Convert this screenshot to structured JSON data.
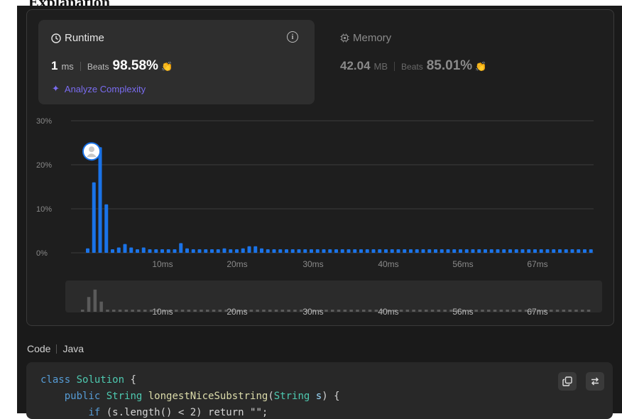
{
  "page_heading_fragment": "Explanation",
  "runtime": {
    "title": "Runtime",
    "value": "1",
    "unit": "ms",
    "beats_label": "Beats",
    "beats_pct": "98.58%",
    "analyze_label": "Analyze Complexity"
  },
  "memory": {
    "title": "Memory",
    "value": "42.04",
    "unit": "MB",
    "beats_label": "Beats",
    "beats_pct": "85.01%"
  },
  "colors": {
    "accent_bar": "#1a73e8",
    "beats_green": "#2db55d",
    "analyze_purple": "#7a6cf0"
  },
  "chart_data": {
    "type": "bar",
    "y_tick_labels": [
      "30%",
      "20%",
      "10%",
      "0%"
    ],
    "ylim": [
      0,
      30
    ],
    "x_tick_labels": [
      "10ms",
      "20ms",
      "30ms",
      "40ms",
      "56ms",
      "67ms"
    ],
    "values": [
      1,
      16,
      24,
      11,
      0.8,
      1.2,
      2,
      1.2,
      0.8,
      1.2,
      0.8,
      0.8,
      0.8,
      0.8,
      0.8,
      2.2,
      1,
      0.8,
      0.8,
      0.8,
      0.8,
      0.8,
      1,
      0.8,
      0.8,
      1,
      1.5,
      1.5,
      1,
      0.8,
      0.8,
      0.8,
      0.8,
      0.8,
      0.8,
      0.8,
      0.8,
      0.8,
      0.8,
      0.8,
      0.8,
      0.8,
      0.8,
      0.8,
      0.8,
      0.8,
      0.8,
      0.8,
      0.8,
      0.8,
      0.8,
      0.8,
      0.8,
      0.8,
      0.8,
      0.8,
      0.8,
      0.8,
      0.8,
      0.8,
      0.8,
      0.8,
      0.8,
      0.8,
      0.8,
      0.8,
      0.8,
      0.8,
      0.8,
      0.8,
      0.8,
      0.8,
      0.8,
      0.8,
      0.8,
      0.8,
      0.8,
      0.8,
      0.8,
      0.8,
      0.8,
      0.8
    ],
    "marker_index": 2,
    "grid": true,
    "legend": "none"
  },
  "code": {
    "label": "Code",
    "language": "Java",
    "line1_class": "class",
    "line1_name": "Solution",
    "line1_brace": "{",
    "line2_public": "public",
    "line2_type": "String",
    "line2_method": "longestNiceSubstring",
    "line2_param_type": "String",
    "line2_param": "s",
    "line3_if": "if",
    "line3_rest": "(s.length() < 2) return \"\";",
    "copy_icon": "copy-icon",
    "wrap_icon": "wrap-icon"
  }
}
